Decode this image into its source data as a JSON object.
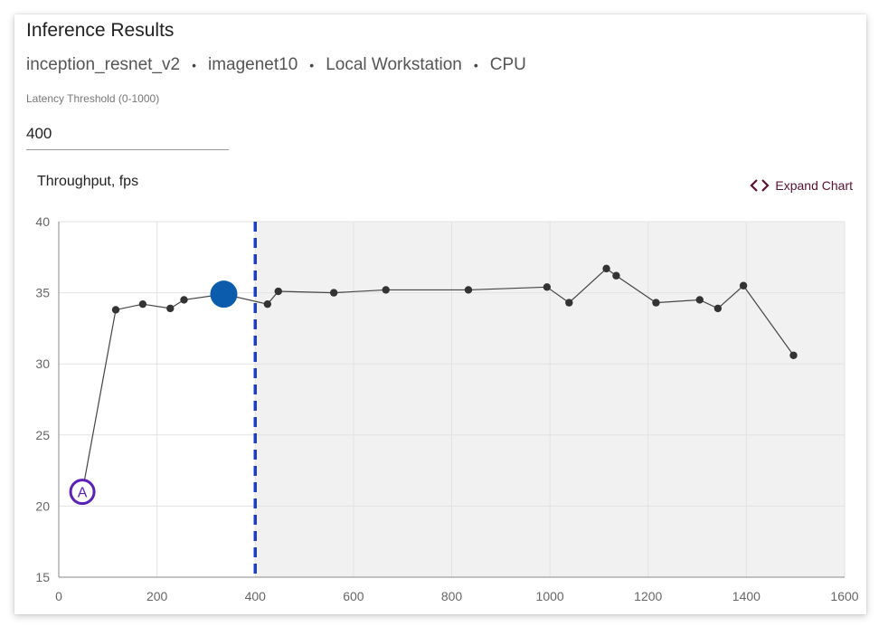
{
  "header": {
    "title": "Inference Results",
    "model": "inception_resnet_v2",
    "dataset": "imagenet10",
    "target": "Local Workstation",
    "device": "CPU",
    "separator": "•"
  },
  "threshold": {
    "label": "Latency Threshold (0-1000)",
    "value": "400"
  },
  "chart_header": {
    "title": "Throughput, fps",
    "expand_label": "Expand Chart"
  },
  "colors": {
    "line": "#444444",
    "point": "#333333",
    "optimal": "#0b5cad",
    "threshold": "#1f3fbf",
    "shade": "#f1f1f1",
    "grid": "#e2e2e2",
    "annotation": "#5b21b6",
    "expand": "#5a1030"
  },
  "chart_data": {
    "type": "line",
    "title": "Throughput, fps",
    "xlabel": "",
    "ylabel": "",
    "xlim": [
      0,
      1600
    ],
    "ylim": [
      15,
      40
    ],
    "xticks": [
      "0",
      "200",
      "400",
      "600",
      "800",
      "1000",
      "1200",
      "1400",
      "1600"
    ],
    "yticks": [
      "15",
      "20",
      "25",
      "30",
      "35",
      "40"
    ],
    "grid": true,
    "threshold_x": 400,
    "series": [
      {
        "points": [
          {
            "x": 48,
            "y": 21.0
          },
          {
            "x": 116,
            "y": 33.8
          },
          {
            "x": 171,
            "y": 34.2
          },
          {
            "x": 227,
            "y": 33.9
          },
          {
            "x": 255,
            "y": 34.5
          },
          {
            "x": 336,
            "y": 34.9
          },
          {
            "x": 425,
            "y": 34.2
          },
          {
            "x": 447,
            "y": 35.1
          },
          {
            "x": 560,
            "y": 35.0
          },
          {
            "x": 666,
            "y": 35.2
          },
          {
            "x": 834,
            "y": 35.2
          },
          {
            "x": 994,
            "y": 35.4
          },
          {
            "x": 1039,
            "y": 34.3
          },
          {
            "x": 1115,
            "y": 36.7
          },
          {
            "x": 1135,
            "y": 36.2
          },
          {
            "x": 1216,
            "y": 34.3
          },
          {
            "x": 1305,
            "y": 34.5
          },
          {
            "x": 1342,
            "y": 33.9
          },
          {
            "x": 1394,
            "y": 35.5
          },
          {
            "x": 1496,
            "y": 30.6
          }
        ]
      }
    ],
    "optimal_point": {
      "x": 336,
      "y": 34.9
    },
    "annotations": [
      {
        "label": "A",
        "x": 48,
        "y": 21.0
      }
    ]
  }
}
